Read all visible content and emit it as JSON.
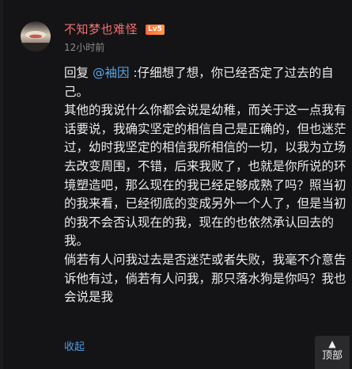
{
  "comment": {
    "username": "不知梦也难怪",
    "level_badge": "Lv5",
    "timestamp": "12小时前",
    "reply_prefix": "回复 ",
    "mention": "@袖因",
    "paragraphs": [
      " :仔细想了想，你已经否定了过去的自己。",
      "其他的我说什么你都会说是幼稚，而关于这一点我有话要说，我确实坚定的相信自己是正确的，但也迷茫过，幼时我坚定的相信我所相信的一切，以我为立场去改变周围，不错，后来我败了，也就是你所说的环境塑造吧，那么现在的我已经足够成熟了吗？照当初的我来看，已经彻底的变成另外一个人了，但是当初的我不会否认现在的我，现在的也依然承认回去的我。",
      "倘若有人问我过去是否迷茫或者失败，我毫不介意告诉他有过，倘若有人问我，那只落水狗是你吗？我也会说是我"
    ],
    "collapse_label": "收起"
  },
  "floating": {
    "top_label": "顶部",
    "top_icon": "arrow-up-icon"
  },
  "colors": {
    "background": "#141416",
    "username": "#f26f6f",
    "link": "#4e9de6",
    "badge": "#ff7a3d"
  }
}
